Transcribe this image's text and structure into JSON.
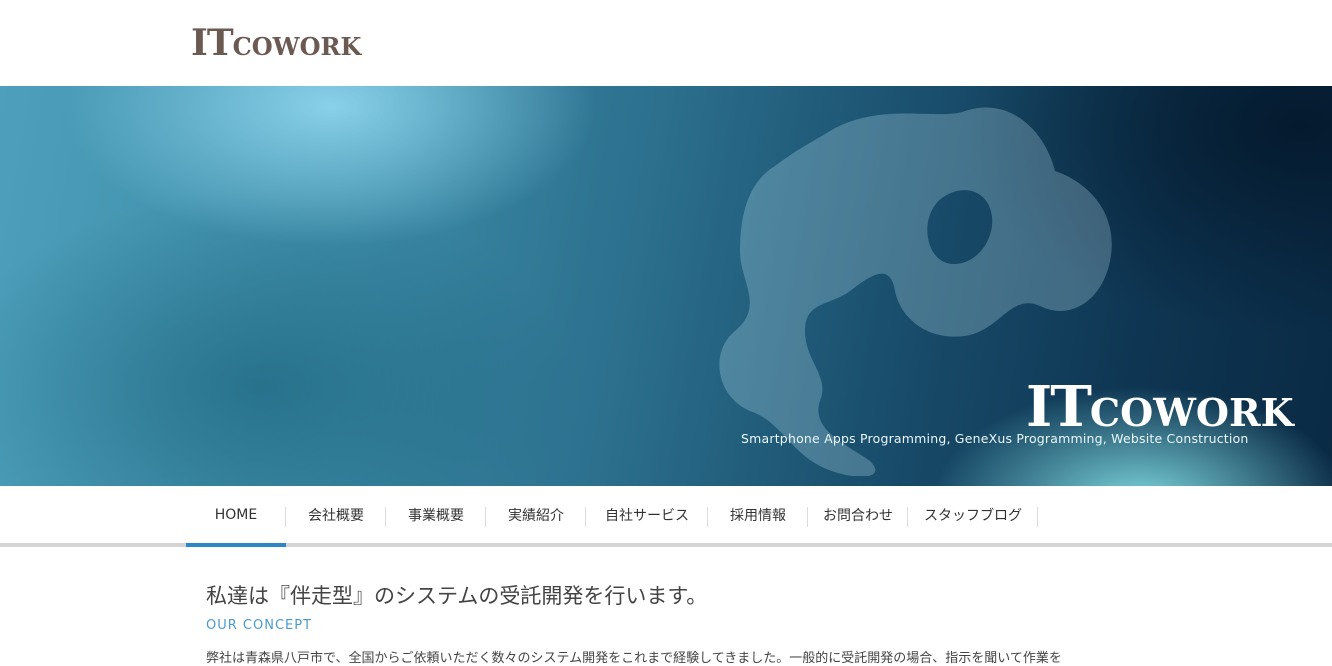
{
  "header": {
    "logo_big": "IT",
    "logo_small": "COWORK"
  },
  "hero": {
    "logo_big": "IT",
    "logo_small": "COWORK",
    "tagline": "Smartphone Apps Programming, GeneXus Programming, Website Construction"
  },
  "nav": {
    "items": [
      {
        "label": "HOME",
        "active": true
      },
      {
        "label": "会社概要"
      },
      {
        "label": "事業概要"
      },
      {
        "label": "実績紹介"
      },
      {
        "label": "自社サービス"
      },
      {
        "label": "採用情報"
      },
      {
        "label": "お問合わせ"
      },
      {
        "label": "スタッフブログ"
      }
    ]
  },
  "content": {
    "headline": "私達は『伴走型』のシステムの受託開発を行います。",
    "subhead": "OUR CONCEPT",
    "paragraph": "弊社は青森県八戸市で、全国からご依頼いただく数々のシステム開発をこれまで経験してきました。一般的に受託開発の場合、指示を聞いて作業を"
  },
  "colors": {
    "accent": "#2a86c6",
    "logo": "#6b5a52",
    "subhead": "#4a9bd0"
  }
}
